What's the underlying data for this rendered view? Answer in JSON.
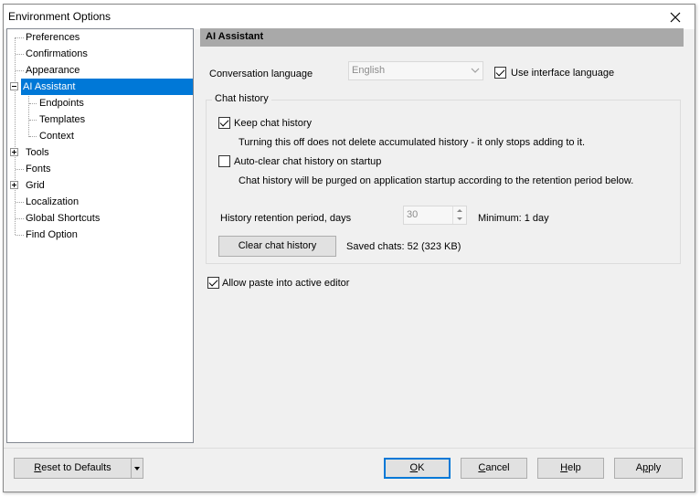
{
  "window": {
    "title": "Environment Options"
  },
  "tree": {
    "items": [
      {
        "label": "Preferences"
      },
      {
        "label": "Confirmations"
      },
      {
        "label": "Appearance"
      },
      {
        "label": "AI Assistant"
      },
      {
        "label": "Endpoints"
      },
      {
        "label": "Templates"
      },
      {
        "label": "Context"
      },
      {
        "label": "Tools"
      },
      {
        "label": "Fonts"
      },
      {
        "label": "Grid"
      },
      {
        "label": "Localization"
      },
      {
        "label": "Global Shortcuts"
      },
      {
        "label": "Find Option"
      }
    ],
    "selected": "AI Assistant"
  },
  "panel": {
    "title": "AI Assistant",
    "conversation_language_label": "Conversation language",
    "conversation_language_value": "English",
    "use_interface_language_label": "Use interface language",
    "use_interface_language_checked": true,
    "chat_history_group": "Chat history",
    "keep_chat_history_label": "Keep chat history",
    "keep_chat_history_checked": true,
    "keep_chat_history_note": "Turning this off does not delete accumulated history - it only stops adding to it.",
    "auto_clear_label": "Auto-clear chat history on startup",
    "auto_clear_checked": false,
    "auto_clear_note": "Chat history will be purged on application startup according to the retention period below.",
    "retention_label": "History retention period, days",
    "retention_value": "30",
    "retention_min": "Minimum: 1 day",
    "clear_button": "Clear chat history",
    "saved_chats": "Saved chats: 52 (323 KB)",
    "allow_paste_label": "Allow paste into active editor",
    "allow_paste_checked": true
  },
  "footer": {
    "reset_label_pre": "",
    "reset_label_u": "R",
    "reset_label_post": "eset to Defaults",
    "ok_u": "O",
    "ok_post": "K",
    "cancel_u": "C",
    "cancel_post": "ancel",
    "help_u": "H",
    "help_post": "elp",
    "apply_pre": "A",
    "apply_u": "p",
    "apply_post": "ply"
  },
  "colors": {
    "selection": "#0078d7",
    "header_bar": "#a9a9a9"
  }
}
